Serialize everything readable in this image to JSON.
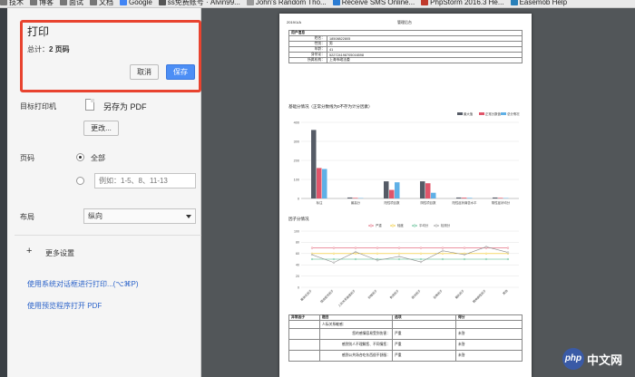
{
  "bookmarks": [
    {
      "label": "技术",
      "icon": "folder-icon",
      "color": "#777777"
    },
    {
      "label": "博客",
      "icon": "folder-icon",
      "color": "#777777"
    },
    {
      "label": "面试",
      "icon": "folder-icon",
      "color": "#777777"
    },
    {
      "label": "文档",
      "icon": "folder-icon",
      "color": "#777777"
    },
    {
      "label": "Google",
      "icon": "google-icon",
      "color": "#4285f4"
    },
    {
      "label": "ss免费账号 · Alvin99...",
      "icon": "page-icon",
      "color": "#555555"
    },
    {
      "label": "John's Random Tho...",
      "icon": "page-icon",
      "color": "#999999"
    },
    {
      "label": "Receive SMS Online...",
      "icon": "page-icon",
      "color": "#2b7cd3"
    },
    {
      "label": "PhpStorm 2016.3 He...",
      "icon": "phpstorm-icon",
      "color": "#c0392b"
    },
    {
      "label": "Easemob Help",
      "icon": "easemob-icon",
      "color": "#2980b9"
    }
  ],
  "dialog": {
    "title": "打印",
    "total_prefix": "总计：",
    "total_value": "2 页码",
    "cancel_label": "取消",
    "save_label": "保存",
    "destination_label": "目标打印机",
    "destination_value": "另存为 PDF",
    "change_label": "更改...",
    "pages_label": "页码",
    "pages_all": "全部",
    "pages_placeholder": "例如：1-5、8、11-13",
    "layout_label": "布局",
    "layout_value": "纵向",
    "more_settings": "更多设置",
    "system_dialog_link": "使用系统对话框进行打印...(⌥⌘P)",
    "open_pdf_link": "使用预览程序打开 PDF"
  },
  "document": {
    "date": "2019/1/A",
    "header_center": "管理后台",
    "user_info_title": "用户信息",
    "user_info_rows": [
      {
        "label": "姓名：",
        "value": "18508822805"
      },
      {
        "label": "性别：",
        "value": "男"
      },
      {
        "label": "年龄：",
        "value": "41"
      },
      {
        "label": "身份证：",
        "value": "522724198705016598"
      },
      {
        "label": "所属机构：",
        "value": "上海市政法委"
      }
    ],
    "bar_title": "基础分情况（正常分数线为0不存为计分因素）",
    "line_title": "因子分情况",
    "factor_table_headers": [
      "异常因子",
      "题目",
      "选项",
      "得分"
    ],
    "factor_table_rows": [
      {
        "factor": "",
        "q": "人际关系敏感：",
        "opt": "",
        "score": ""
      },
      {
        "factor": "",
        "q": "您的感情容易受到伤害：",
        "opt": "严重",
        "score": "未答"
      },
      {
        "factor": "",
        "q": "感到别人不理解您、不同情您：",
        "opt": "严重",
        "score": "未答"
      },
      {
        "factor": "",
        "q": "感到公共场合吃东西很不舒服：",
        "opt": "严重",
        "score": "未答"
      }
    ]
  },
  "watermark": {
    "circle": "php",
    "text": "中文网"
  },
  "chart_data": [
    {
      "type": "bar",
      "title": "",
      "categories": [
        "标注",
        "最高分",
        "阳性项目数",
        "阴性项目数",
        "阳性症状痛苦水平",
        "阴性症状均分"
      ],
      "series": [
        {
          "name": "最大值",
          "color": "#555b66",
          "values": [
            360,
            5,
            90,
            90,
            5,
            5
          ]
        },
        {
          "name": "正常分数值",
          "color": "#e0556a",
          "values": [
            160,
            3,
            45,
            80,
            4,
            3
          ]
        },
        {
          "name": "总分情况",
          "color": "#5fb0e6",
          "values": [
            155,
            2,
            85,
            30,
            3,
            2
          ]
        }
      ],
      "ylim": [
        0,
        400
      ],
      "yticks": [
        0,
        100,
        200,
        300,
        400
      ],
      "legend": "top-right",
      "grid": true
    },
    {
      "type": "line",
      "title": "",
      "categories": [
        "躯体化因子",
        "强迫症状因子",
        "人际关系敏感因子",
        "抑郁因子",
        "焦虑因子",
        "敌对因子",
        "恐怖因子",
        "偏执因子",
        "精神病性因子",
        "其他"
      ],
      "series": [
        {
          "name": "严重",
          "color": "#e0556a",
          "values": [
            70,
            70,
            70,
            70,
            70,
            70,
            70,
            70,
            70,
            70
          ]
        },
        {
          "name": "轻度",
          "color": "#f0c419",
          "values": [
            60,
            60,
            60,
            60,
            60,
            60,
            60,
            60,
            60,
            60
          ]
        },
        {
          "name": "平均分",
          "color": "#3ab07d",
          "values": [
            50,
            50,
            50,
            50,
            50,
            50,
            50,
            50,
            50,
            50
          ]
        },
        {
          "name": "检测分",
          "color": "#888888",
          "values": [
            58,
            44,
            63,
            48,
            55,
            45,
            65,
            58,
            72,
            62
          ]
        }
      ],
      "ylim": [
        0,
        100
      ],
      "yticks": [
        0,
        20,
        40,
        60,
        80,
        100
      ],
      "legend": "top",
      "grid": true
    }
  ]
}
